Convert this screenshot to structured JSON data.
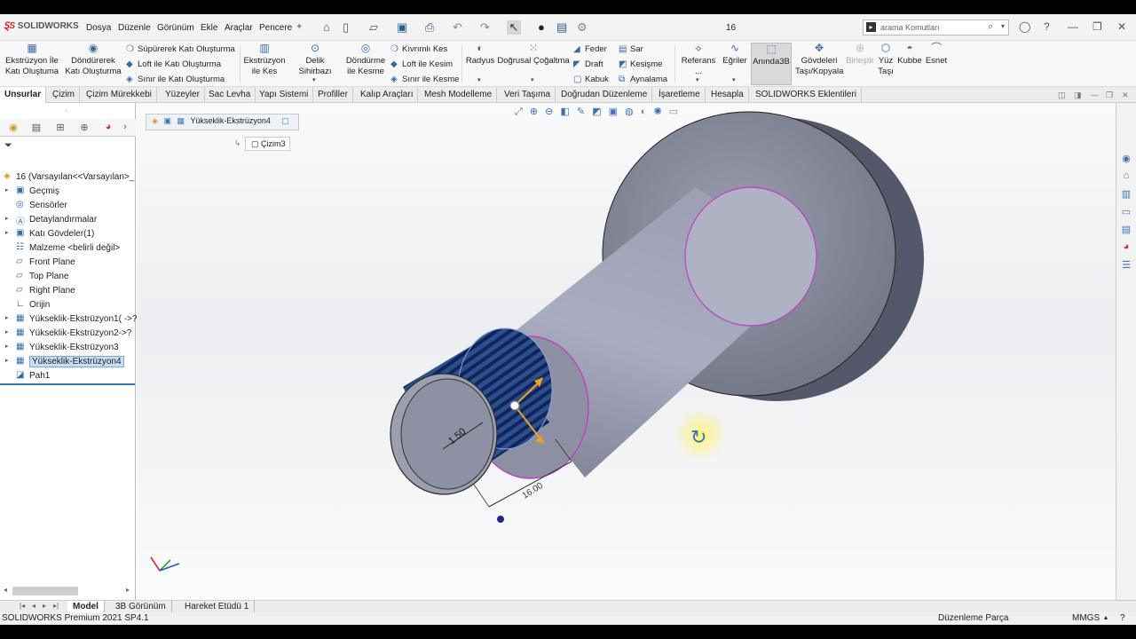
{
  "app": {
    "logo": "SOLIDWORKS",
    "document_name": "16"
  },
  "menu": [
    "Dosya",
    "Düzenle",
    "Görünüm",
    "Ekle",
    "Araçlar",
    "Pencere"
  ],
  "search": {
    "placeholder": "arama Komutları"
  },
  "ribbon": {
    "extrude_boss": "Ekstrüzyon İle Katı Oluştuma",
    "revolve_boss": "Döndürerek Katı Oluşturma",
    "sweep_boss": "Süpürerek Katı Oluşturma",
    "loft_boss": "Loft ile Katı Oluşturma",
    "boundary_boss": "Sınır ile Katı Oluşturma",
    "extrude_cut": "Ekstrüzyon ile Kes",
    "hole_wizard": "Delik Sihirbazı",
    "revolve_cut": "Döndürme ile Kesme",
    "swept_cut": "Kıvrımlı Kes",
    "loft_cut": "Loft ile Kesim",
    "boundary_cut": "Sınır ile Kesme",
    "fillet": "Radyus",
    "linear_pattern": "Doğrusal Çoğaltma",
    "rib": "Feder",
    "draft": "Draft",
    "shell": "Kabuk",
    "wrap": "Sar",
    "intersect": "Kesişme",
    "mirror": "Aynalama",
    "reference": "Referans ...",
    "curves": "Eğriler",
    "instant3d": "Anında3B",
    "move_bodies": "Gövdeleri Taşı/Kopyala",
    "combine": "Birleştir",
    "move_face": "Yüz Taşı",
    "dome": "Kubbe",
    "flex": "Esnet"
  },
  "tabs": [
    "Unsurlar",
    "Çizim",
    "Çizim Mürekkebi",
    "Yüzeyler",
    "Sac Levha",
    "Yapı Sistemi",
    "Profiller",
    "Kalıp Araçları",
    "Mesh Modelleme",
    "Veri Taşıma",
    "Doğrudan Düzenleme",
    "İşaretleme",
    "Hesapla",
    "SOLIDWORKS Eklentileri"
  ],
  "tree": {
    "root": "16  (Varsayılan<<Varsayılan>_",
    "items": [
      {
        "label": "Geçmiş",
        "expand": true,
        "icon": "history-icon"
      },
      {
        "label": "Sensörler",
        "expand": false,
        "icon": "sensor-icon"
      },
      {
        "label": "Detaylandırmalar",
        "expand": true,
        "icon": "annotation-icon"
      },
      {
        "label": "Katı Gövdeler(1)",
        "expand": true,
        "icon": "solid-bodies-icon"
      },
      {
        "label": "Malzeme <belirli değil>",
        "expand": false,
        "icon": "material-icon"
      },
      {
        "label": "Front Plane",
        "expand": false,
        "icon": "plane-icon"
      },
      {
        "label": "Top Plane",
        "expand": false,
        "icon": "plane-icon"
      },
      {
        "label": "Right Plane",
        "expand": false,
        "icon": "plane-icon"
      },
      {
        "label": "Orijin",
        "expand": false,
        "icon": "origin-icon"
      },
      {
        "label": "Yükseklik-Ekstrüzyon1( ->?)",
        "expand": true,
        "icon": "extrude-icon"
      },
      {
        "label": "Yükseklik-Ekstrüzyon2->?",
        "expand": true,
        "icon": "extrude-icon"
      },
      {
        "label": "Yükseklik-Ekstrüzyon3",
        "expand": true,
        "icon": "extrude-icon"
      },
      {
        "label": "Yükseklik-Ekstrüzyon4",
        "expand": true,
        "icon": "extrude-icon",
        "selected": true
      },
      {
        "label": "Pah1",
        "expand": false,
        "icon": "chamfer-icon"
      }
    ]
  },
  "breadcrumb": {
    "feature": "Yükseklik-Ekstrüzyon4",
    "sketch": "Çizim3"
  },
  "dimensions": {
    "thread_pitch": "1.50",
    "length": "16.00"
  },
  "bottom_tabs": [
    "Model",
    "3B Görünüm",
    "Hareket Etüdü 1"
  ],
  "status": {
    "product": "SOLIDWORKS Premium 2021 SP4.1",
    "mode": "Düzenleme Parça",
    "units": "MMGS"
  }
}
